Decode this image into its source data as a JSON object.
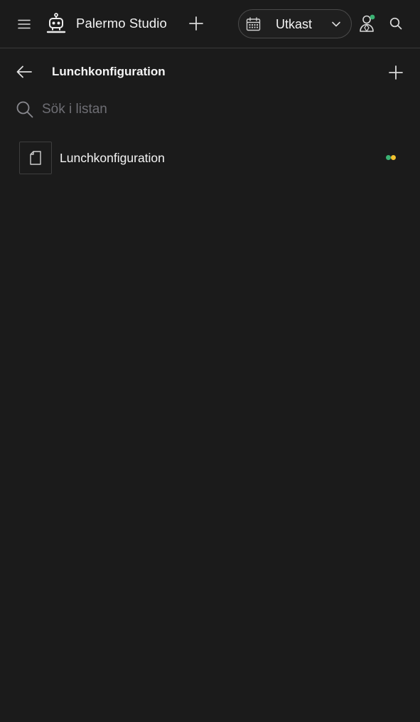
{
  "header": {
    "app_title": "Palermo Studio",
    "status": {
      "label": "Utkast"
    }
  },
  "subheader": {
    "title": "Lunchkonfiguration"
  },
  "search": {
    "placeholder": "Sök i listan",
    "value": ""
  },
  "list": {
    "items": [
      {
        "title": "Lunchkonfiguration",
        "status_colors": [
          "#3bb273",
          "#f2c230"
        ]
      }
    ]
  },
  "icons": {
    "menu": "hamburger-menu-icon",
    "logo": "robot-icon",
    "add": "plus-icon",
    "calendar": "calendar-icon",
    "chevron": "chevron-down-icon",
    "user": "user-icon",
    "search": "search-icon",
    "back": "arrow-left-icon",
    "document": "document-icon"
  },
  "colors": {
    "background": "#1b1b1b",
    "online_indicator": "#3bb273"
  }
}
